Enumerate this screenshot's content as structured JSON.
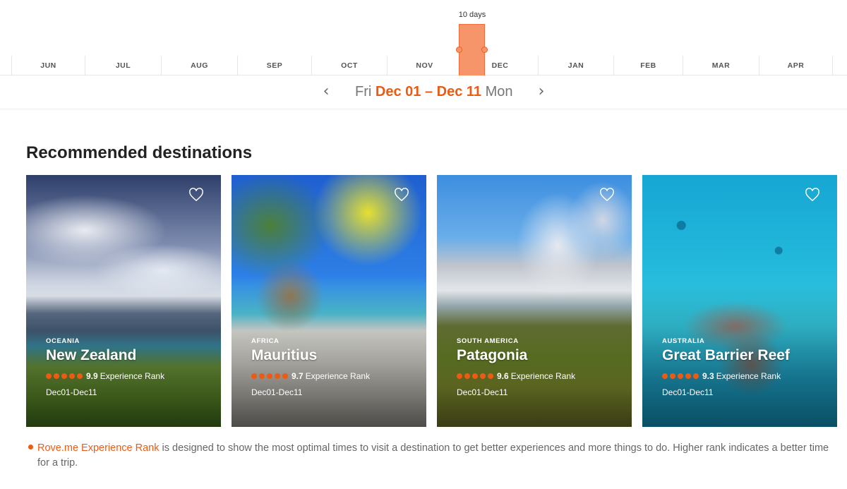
{
  "timeline": {
    "months": [
      "JUN",
      "JUL",
      "AUG",
      "SEP",
      "OCT",
      "NOV",
      "DEC",
      "JAN",
      "FEB",
      "MAR",
      "APR"
    ],
    "selection_label": "10 days",
    "selection_color": "#f7956a"
  },
  "date_bar": {
    "prev_icon": "chevron-left",
    "next_icon": "chevron-right",
    "start_day": "Fri",
    "start_date": "Dec 01",
    "separator": "–",
    "end_date": "Dec 11",
    "end_day": "Mon"
  },
  "section": {
    "title": "Recommended destinations"
  },
  "cards": [
    {
      "region": "OCEANIA",
      "name": "New Zealand",
      "score": "9.9",
      "rank_label": "Experience Rank",
      "dates": "Dec01-Dec11",
      "rating_dots": 5
    },
    {
      "region": "AFRICA",
      "name": "Mauritius",
      "score": "9.7",
      "rank_label": "Experience Rank",
      "dates": "Dec01-Dec11",
      "rating_dots": 5
    },
    {
      "region": "SOUTH AMERICA",
      "name": "Patagonia",
      "score": "9.6",
      "rank_label": "Experience Rank",
      "dates": "Dec01-Dec11",
      "rating_dots": 5
    },
    {
      "region": "AUSTRALIA",
      "name": "Great Barrier Reef",
      "score": "9.3",
      "rank_label": "Experience Rank",
      "dates": "Dec01-Dec11",
      "rating_dots": 5
    }
  ],
  "footnote": {
    "brand": "Rove.me Experience Rank",
    "text": " is designed to show the most optimal times to visit a destination to get better experiences and more things to do. Higher rank indicates a better time for a trip."
  },
  "colors": {
    "accent": "#ec5b13",
    "text": "#333333",
    "muted": "#777777"
  }
}
